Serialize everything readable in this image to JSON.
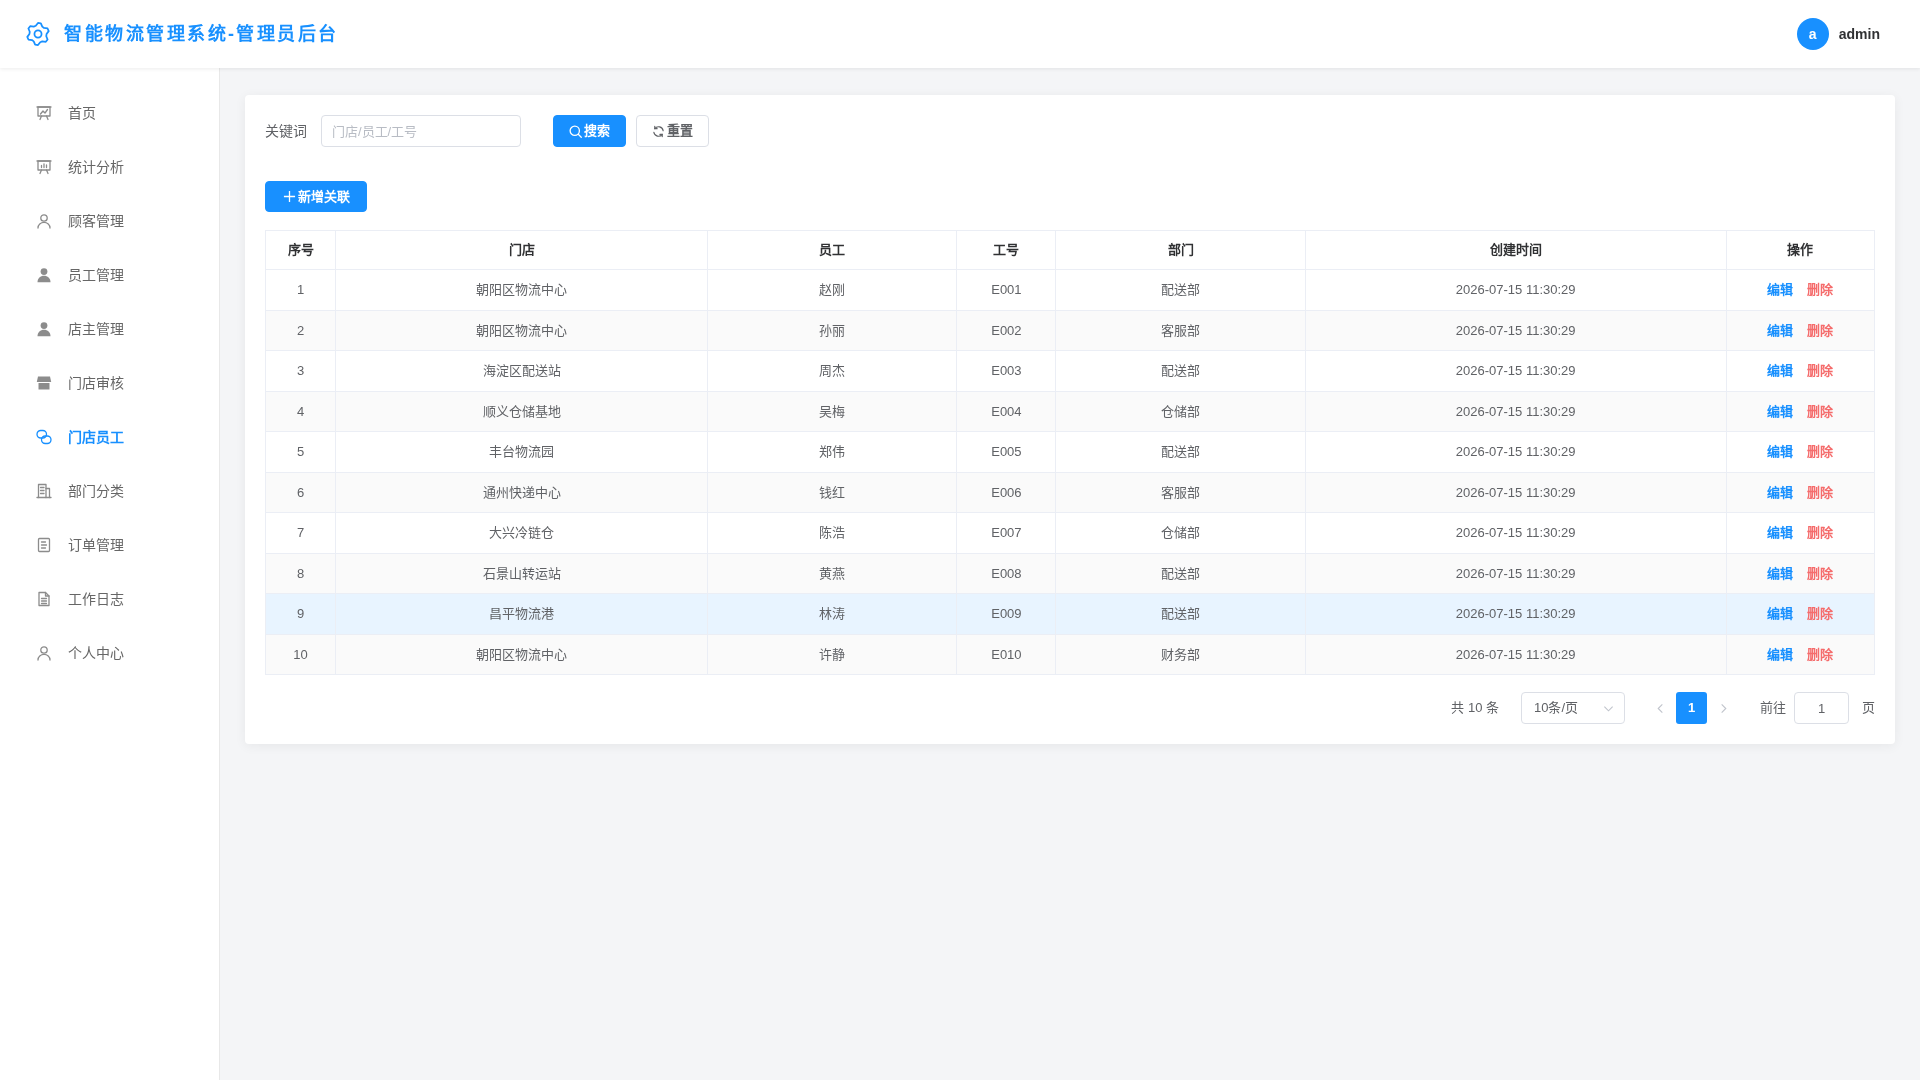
{
  "header": {
    "title": "智能物流管理系统-管理员后台",
    "user": {
      "avatar_letter": "a",
      "name": "admin"
    }
  },
  "sidebar": {
    "items": [
      {
        "label": "首页",
        "selected": false
      },
      {
        "label": "统计分析",
        "selected": false
      },
      {
        "label": "顾客管理",
        "selected": false
      },
      {
        "label": "员工管理",
        "selected": false
      },
      {
        "label": "店主管理",
        "selected": false
      },
      {
        "label": "门店审核",
        "selected": false
      },
      {
        "label": "门店员工",
        "selected": true
      },
      {
        "label": "部门分类",
        "selected": false
      },
      {
        "label": "订单管理",
        "selected": false
      },
      {
        "label": "工作日志",
        "selected": false
      },
      {
        "label": "个人中心",
        "selected": false
      }
    ]
  },
  "filter": {
    "label": "关键词",
    "placeholder": "门店/员工/工号",
    "search_button": "搜索",
    "reset_button": "重置"
  },
  "add_button": "新增关联",
  "table": {
    "columns": [
      "序号",
      "门店",
      "员工",
      "工号",
      "部门",
      "创建时间",
      "操作"
    ],
    "rows": [
      {
        "cells": [
          "1",
          "朝阳区物流中心",
          "赵刚",
          "E001",
          "配送部",
          "2026-07-15 11:30:29"
        ],
        "actions": [
          {
            "label": "编辑",
            "kind": "edit"
          },
          {
            "label": "删除",
            "kind": "delete"
          }
        ],
        "selected": false
      },
      {
        "cells": [
          "2",
          "朝阳区物流中心",
          "孙丽",
          "E002",
          "客服部",
          "2026-07-15 11:30:29"
        ],
        "actions": [
          {
            "label": "编辑",
            "kind": "edit"
          },
          {
            "label": "删除",
            "kind": "delete"
          }
        ],
        "selected": false
      },
      {
        "cells": [
          "3",
          "海淀区配送站",
          "周杰",
          "E003",
          "配送部",
          "2026-07-15 11:30:29"
        ],
        "actions": [
          {
            "label": "编辑",
            "kind": "edit"
          },
          {
            "label": "删除",
            "kind": "delete"
          }
        ],
        "selected": false
      },
      {
        "cells": [
          "4",
          "顺义仓储基地",
          "吴梅",
          "E004",
          "仓储部",
          "2026-07-15 11:30:29"
        ],
        "actions": [
          {
            "label": "编辑",
            "kind": "edit"
          },
          {
            "label": "删除",
            "kind": "delete"
          }
        ],
        "selected": false
      },
      {
        "cells": [
          "5",
          "丰台物流园",
          "郑伟",
          "E005",
          "配送部",
          "2026-07-15 11:30:29"
        ],
        "actions": [
          {
            "label": "编辑",
            "kind": "edit"
          },
          {
            "label": "删除",
            "kind": "delete"
          }
        ],
        "selected": false
      },
      {
        "cells": [
          "6",
          "通州快递中心",
          "钱红",
          "E006",
          "客服部",
          "2026-07-15 11:30:29"
        ],
        "actions": [
          {
            "label": "编辑",
            "kind": "edit"
          },
          {
            "label": "删除",
            "kind": "delete"
          }
        ],
        "selected": false
      },
      {
        "cells": [
          "7",
          "大兴冷链仓",
          "陈浩",
          "E007",
          "仓储部",
          "2026-07-15 11:30:29"
        ],
        "actions": [
          {
            "label": "编辑",
            "kind": "edit"
          },
          {
            "label": "删除",
            "kind": "delete"
          }
        ],
        "selected": false
      },
      {
        "cells": [
          "8",
          "石景山转运站",
          "黄燕",
          "E008",
          "配送部",
          "2026-07-15 11:30:29"
        ],
        "actions": [
          {
            "label": "编辑",
            "kind": "edit"
          },
          {
            "label": "删除",
            "kind": "delete"
          }
        ],
        "selected": false
      },
      {
        "cells": [
          "9",
          "昌平物流港",
          "林涛",
          "E009",
          "配送部",
          "2026-07-15 11:30:29"
        ],
        "actions": [
          {
            "label": "编辑",
            "kind": "edit"
          },
          {
            "label": "删除",
            "kind": "delete"
          }
        ],
        "selected": true
      },
      {
        "cells": [
          "10",
          "朝阳区物流中心",
          "许静",
          "E010",
          "财务部",
          "2026-07-15 11:30:29"
        ],
        "actions": [
          {
            "label": "编辑",
            "kind": "edit"
          },
          {
            "label": "删除",
            "kind": "delete"
          }
        ],
        "selected": false
      }
    ]
  },
  "pagination": {
    "total": "共 10 条",
    "page_size": "10条/页",
    "prev": {
      "disabled": true
    },
    "pages": [
      {
        "label": "1",
        "selected": true
      }
    ],
    "next": {
      "disabled": true
    },
    "goto_label": "前往",
    "goto_value": "1",
    "goto_suffix": "页"
  }
}
